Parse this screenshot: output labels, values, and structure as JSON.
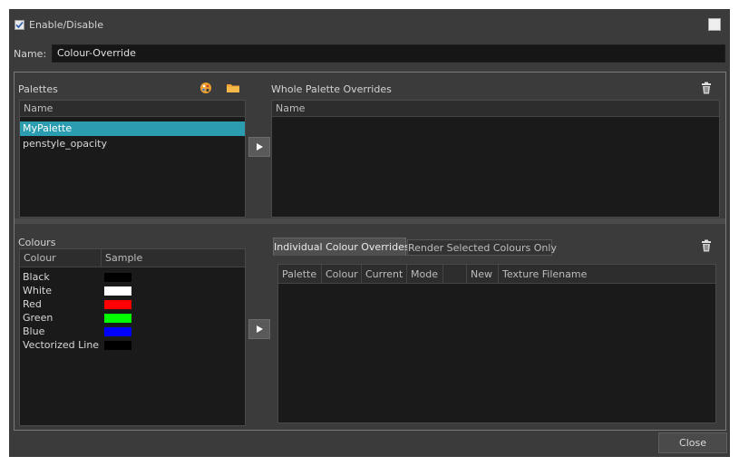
{
  "enable": {
    "label": "Enable/Disable",
    "checked": true
  },
  "name_field": {
    "label": "Name:",
    "value": "Colour-Override"
  },
  "palettes": {
    "title": "Palettes",
    "column": "Name",
    "items": [
      "MyPalette",
      "penstyle_opacity"
    ],
    "selected": "MyPalette",
    "icons": [
      "palette-icon",
      "folder-icon"
    ]
  },
  "whole_overrides": {
    "title": "Whole Palette Overrides",
    "column": "Name",
    "icon": "trash-icon"
  },
  "colours": {
    "title": "Colours",
    "columns": [
      "Colour",
      "Sample"
    ],
    "rows": [
      {
        "name": "Black",
        "color": "#000000"
      },
      {
        "name": "White",
        "color": "#ffffff"
      },
      {
        "name": "Red",
        "color": "#ff0000"
      },
      {
        "name": "Green",
        "color": "#00ff00"
      },
      {
        "name": "Blue",
        "color": "#0000ff"
      },
      {
        "name": "Vectorized Line",
        "color": "#000000"
      }
    ]
  },
  "overrides": {
    "tabs": [
      "Individual Colour Overrides",
      "Render Selected Colours Only"
    ],
    "active_tab": "Individual Colour Overrides",
    "columns": [
      "Palette",
      "Colour",
      "Current",
      "Mode",
      "",
      "New",
      "Texture Filename"
    ],
    "icon": "trash-icon"
  },
  "footer": {
    "close_label": "Close"
  },
  "colors": {
    "selection": "#2b9db0",
    "background": "#3b3b3b",
    "panel": "#1a1a1a"
  }
}
